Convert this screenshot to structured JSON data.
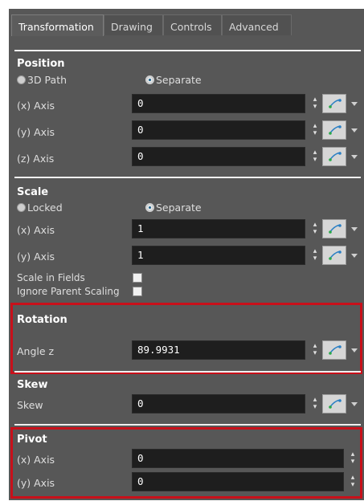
{
  "tabs": {
    "transformation": "Transformation",
    "drawing": "Drawing",
    "controls": "Controls",
    "advanced": "Advanced"
  },
  "position": {
    "title": "Position",
    "radio1": "3D Path",
    "radio2": "Separate",
    "x_label": "(x) Axis",
    "x_value": "0",
    "y_label": "(y) Axis",
    "y_value": "0",
    "z_label": "(z) Axis",
    "z_value": "0"
  },
  "scale": {
    "title": "Scale",
    "radio1": "Locked",
    "radio2": "Separate",
    "x_label": "(x) Axis",
    "x_value": "1",
    "y_label": "(y) Axis",
    "y_value": "1",
    "fields_label": "Scale in Fields",
    "parent_label": "Ignore Parent Scaling"
  },
  "rotation": {
    "title": "Rotation",
    "angle_label": "Angle z",
    "angle_value": "89.9931"
  },
  "skew": {
    "title": "Skew",
    "label": "Skew",
    "value": "0"
  },
  "pivot": {
    "title": "Pivot",
    "x_label": "(x) Axis",
    "x_value": "0",
    "y_label": "(y) Axis",
    "y_value": "0"
  },
  "colors": {
    "panel": "#575757",
    "field": "#1e1e1e",
    "highlight": "#c8101a"
  }
}
